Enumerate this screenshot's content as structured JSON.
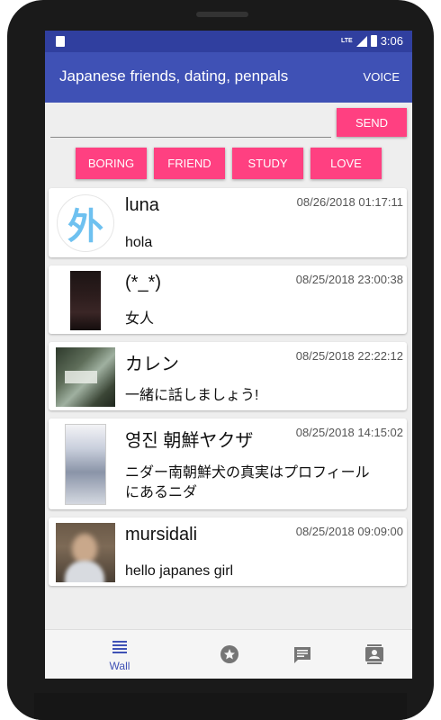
{
  "status_bar": {
    "network": "LTE",
    "time": "3:06"
  },
  "app_bar": {
    "title": "Japanese friends, dating, penpals",
    "action": "VOICE"
  },
  "composer": {
    "value": "",
    "placeholder": "",
    "send_label": "SEND"
  },
  "quick_chips": [
    "BORING",
    "FRIEND",
    "STUDY",
    "LOVE"
  ],
  "posts": [
    {
      "name": "luna",
      "timestamp": "08/26/2018 01:17:11",
      "message": "hola",
      "avatar_glyph": "外",
      "avatar_color": "#6ec1f0"
    },
    {
      "name": "(*_*)",
      "timestamp": "08/25/2018 23:00:38",
      "message": "女人"
    },
    {
      "name": "カレン",
      "timestamp": "08/25/2018 22:22:12",
      "message": "一緒に話しましょう!"
    },
    {
      "name": "영진 朝鮮ヤクザ",
      "timestamp": "08/25/2018 14:15:02",
      "message_line1": "ニダー南朝鮮犬の真実はプロフィール",
      "message_line2": "にあるニダ"
    },
    {
      "name": "mursidali",
      "timestamp": "08/25/2018 09:09:00",
      "message": "hello japanes girl"
    }
  ],
  "bottom_nav": {
    "active": "wall",
    "items": [
      {
        "id": "wall",
        "label": "Wall",
        "icon": "list-icon"
      },
      {
        "id": "favorites",
        "label": "",
        "icon": "star-icon"
      },
      {
        "id": "messages",
        "label": "",
        "icon": "chat-icon"
      },
      {
        "id": "contacts",
        "label": "",
        "icon": "contact-card-icon"
      }
    ]
  },
  "colors": {
    "primary": "#3f51b5",
    "primary_dark": "#303f9f",
    "accent": "#ff4081"
  }
}
